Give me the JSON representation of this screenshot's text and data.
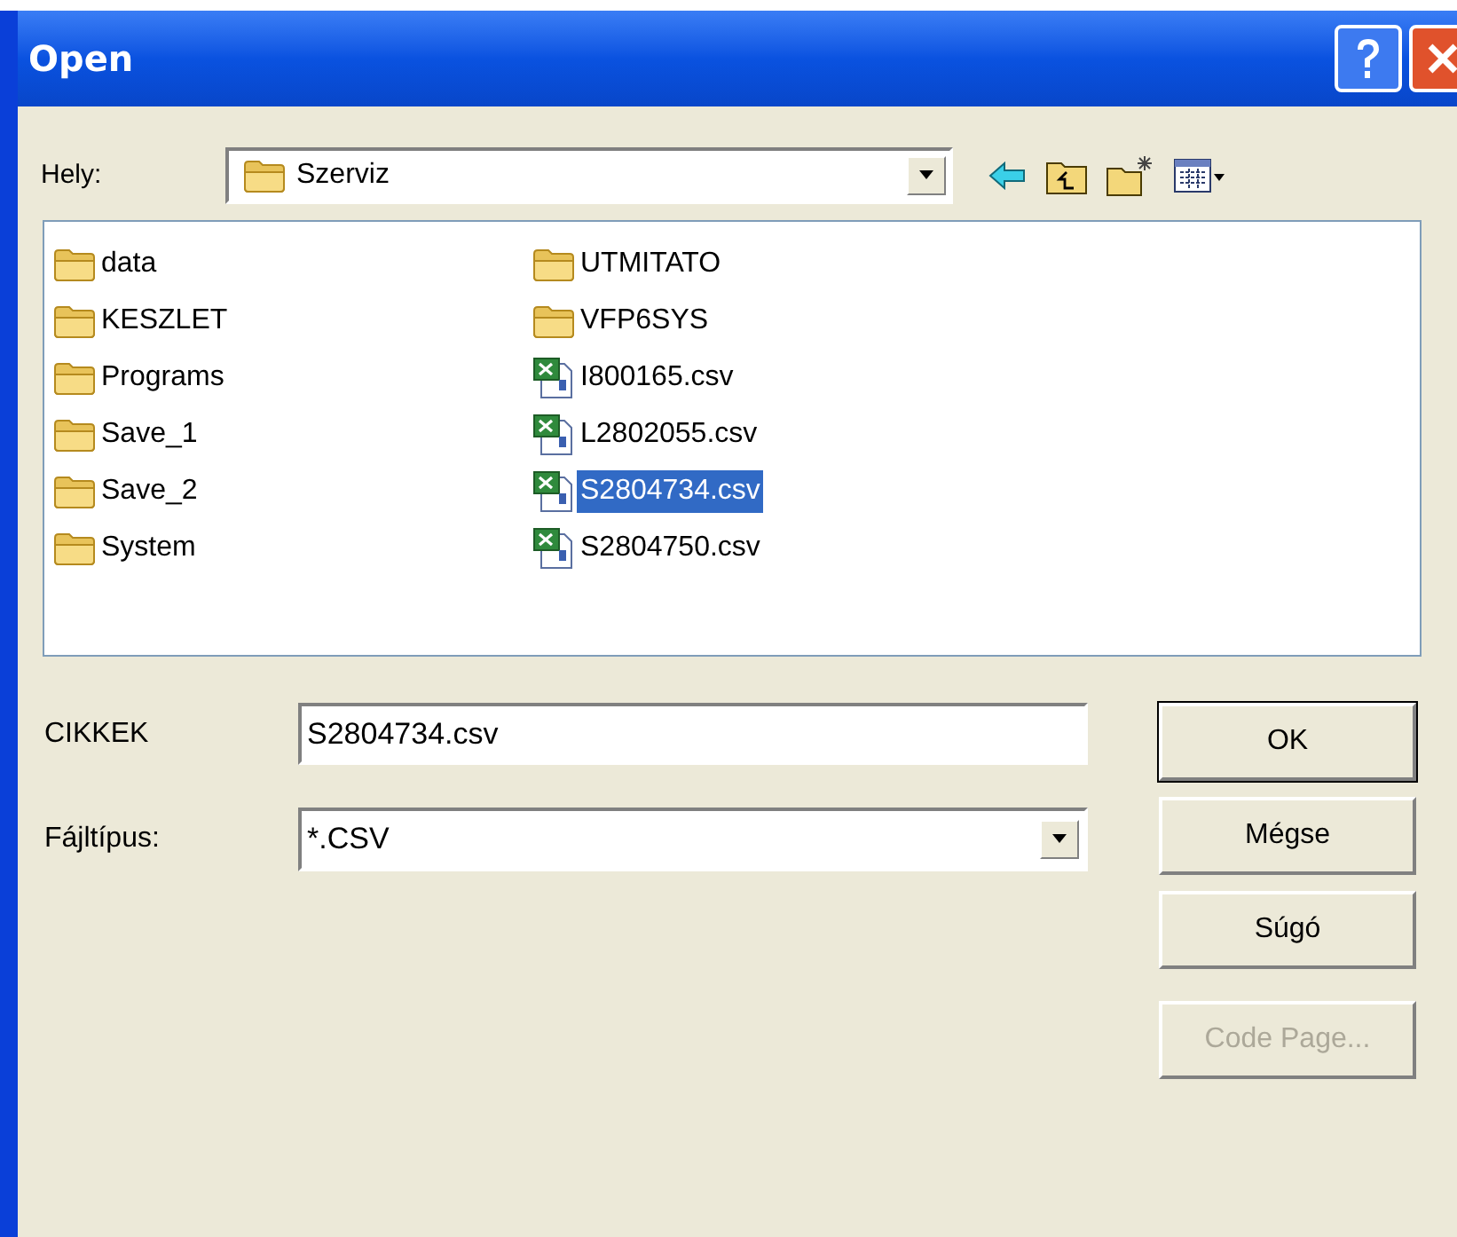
{
  "window": {
    "title": "Open"
  },
  "location": {
    "label": "Hely:",
    "value": "Szerviz"
  },
  "files": [
    {
      "name": "data",
      "kind": "folder",
      "selected": false
    },
    {
      "name": "KESZLET",
      "kind": "folder",
      "selected": false
    },
    {
      "name": "Programs",
      "kind": "folder",
      "selected": false
    },
    {
      "name": "Save_1",
      "kind": "folder",
      "selected": false
    },
    {
      "name": "Save_2",
      "kind": "folder",
      "selected": false
    },
    {
      "name": "System",
      "kind": "folder",
      "selected": false
    },
    {
      "name": "UTMITATO",
      "kind": "folder",
      "selected": false
    },
    {
      "name": "VFP6SYS",
      "kind": "folder",
      "selected": false
    },
    {
      "name": "I800165.csv",
      "kind": "csv",
      "selected": false
    },
    {
      "name": "L2802055.csv",
      "kind": "csv",
      "selected": false
    },
    {
      "name": "S2804734.csv",
      "kind": "csv",
      "selected": true
    },
    {
      "name": "S2804750.csv",
      "kind": "csv",
      "selected": false
    }
  ],
  "file_name": {
    "label": "CIKKEK",
    "value": "S2804734.csv"
  },
  "file_type": {
    "label": "Fájltípus:",
    "value": "*.CSV"
  },
  "buttons": [
    {
      "label": "OK",
      "default": true,
      "disabled": false
    },
    {
      "label": "Mégse",
      "default": false,
      "disabled": false
    },
    {
      "label": "Súgó",
      "default": false,
      "disabled": false
    },
    {
      "label": "Code Page...",
      "default": false,
      "disabled": true
    }
  ]
}
